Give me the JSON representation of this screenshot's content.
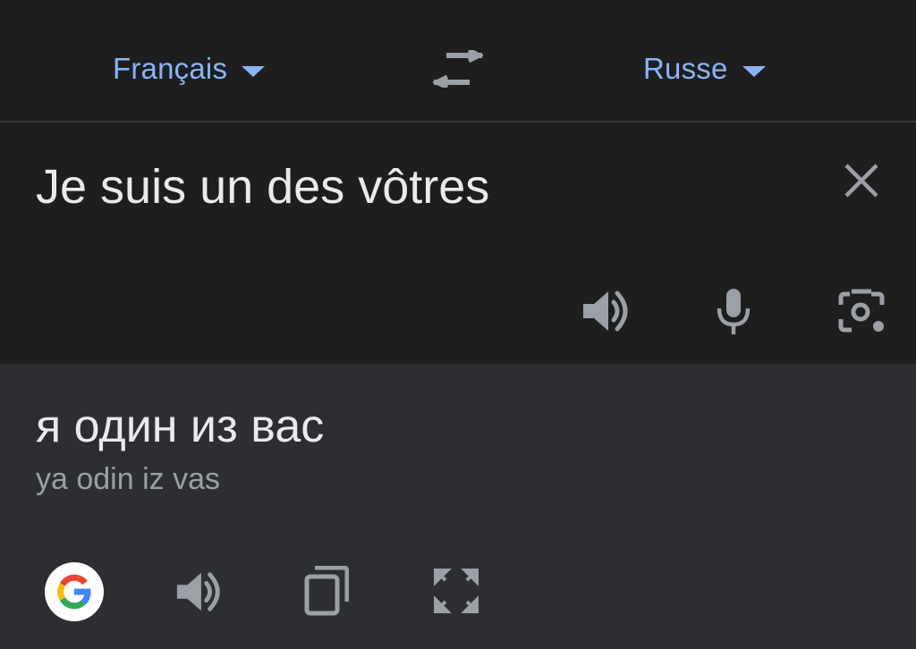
{
  "languages": {
    "source": "Français",
    "target": "Russe"
  },
  "source_panel": {
    "text": "Je suis un des vôtres"
  },
  "result_panel": {
    "translation": "я один из вас",
    "transliteration": "ya odin iz vas"
  },
  "icons": {
    "swap": "swap-arrows-icon",
    "clear": "close-icon",
    "source_speak": "speaker-icon",
    "mic": "microphone-icon",
    "camera": "camera-lens-icon",
    "google": "google-g-icon",
    "result_speak": "speaker-icon",
    "copy": "copy-icon",
    "fullscreen": "fullscreen-icon"
  },
  "colors": {
    "accent": "#8ab4f8",
    "background": "#1e1e1f",
    "result_background": "#2d2e31",
    "text": "#e8eaed",
    "muted": "#9aa0a6",
    "icon": "#9aa0a6"
  }
}
